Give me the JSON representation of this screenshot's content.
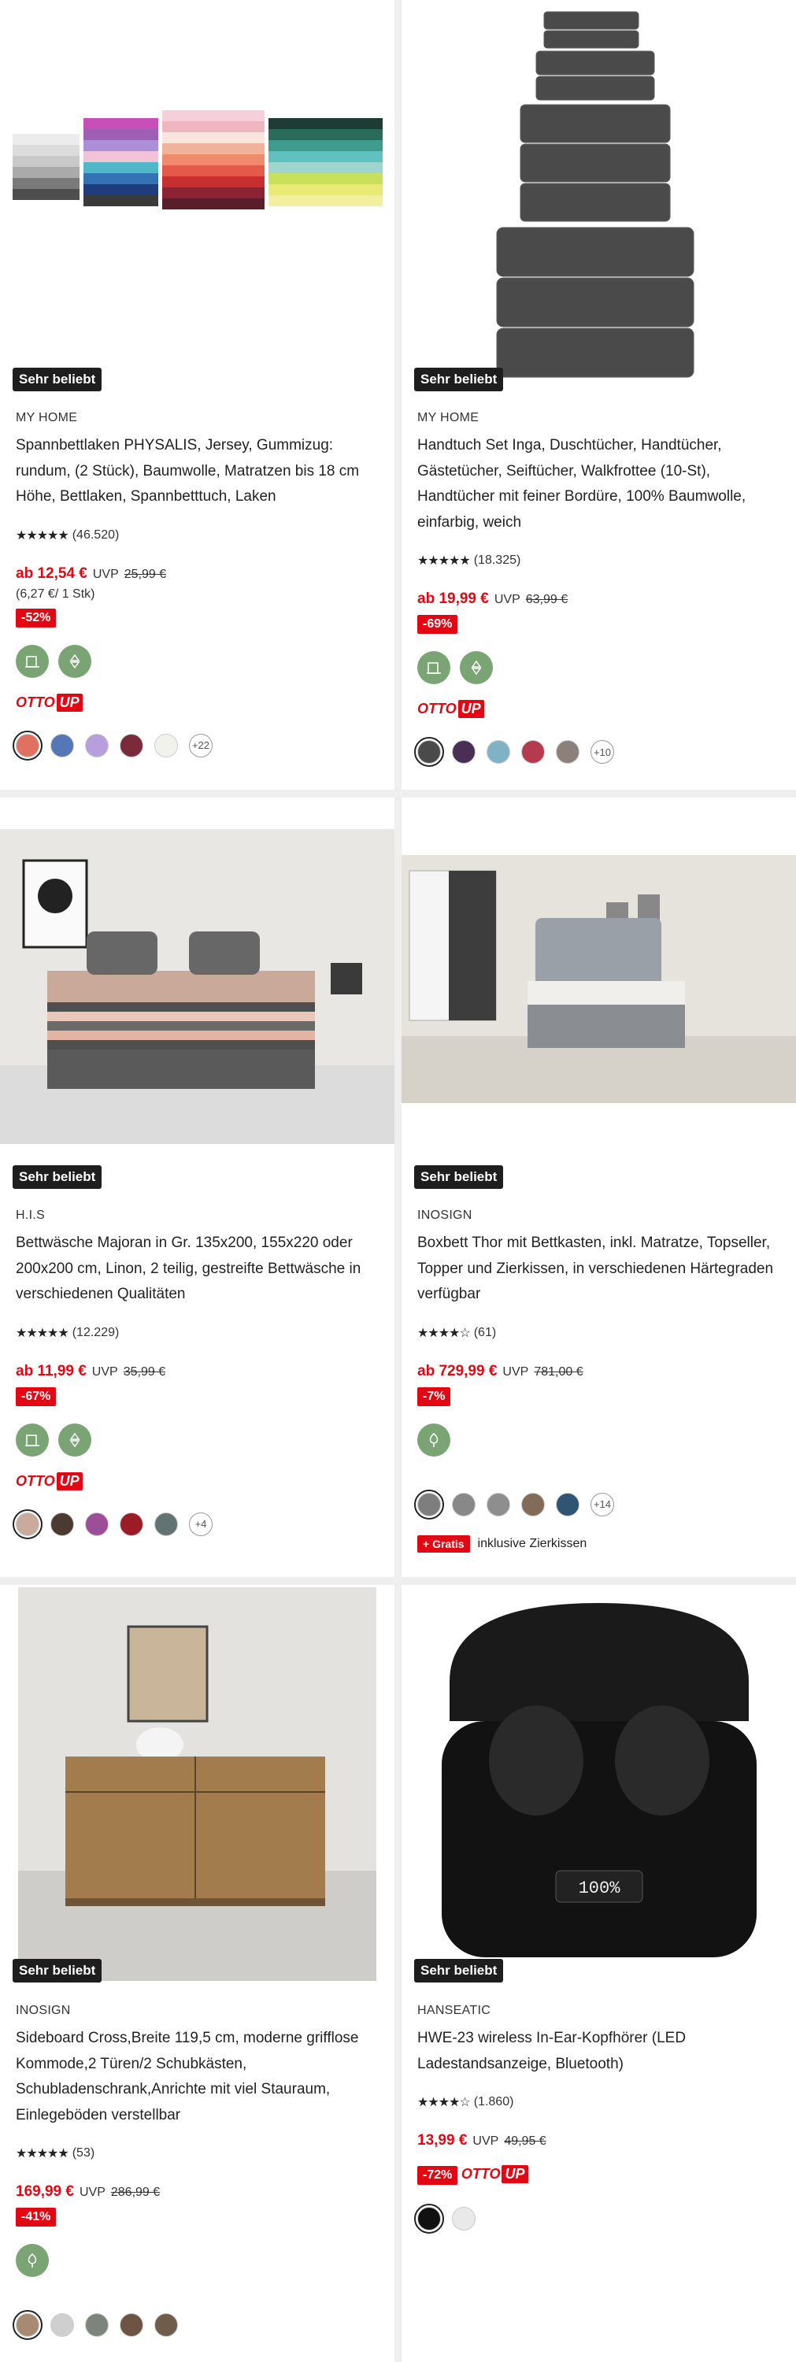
{
  "colors": {
    "price_red": "#e30613",
    "eco_green": "#7aa474",
    "badge_dark": "#1e1e1e"
  },
  "products": [
    {
      "badge": "Sehr beliebt",
      "brand": "MY HOME",
      "title": "Spannbettlaken PHYSALIS, Jersey, Gummizug: rundum, (2 Stück), Baumwolle, Matratzen bis 18 cm Höhe, Bettlaken, Spannbetttuch, Laken",
      "stars": "★★★★★",
      "rating_count": "(46.520)",
      "price": "ab 12,54 €",
      "uvp_label": "UVP",
      "old_price": "25,99 €",
      "unit_price": "(6,27 €/ 1 Stk)",
      "discount": "-52%",
      "eco_icons": [
        "sustainability-icon",
        "planet-icon"
      ],
      "otto_up": "OTTO",
      "otto_up_tag": "UP",
      "swatches": [
        "#e07060",
        "#5577b5",
        "#b79fde",
        "#7a2a3a",
        "#f2f2ec"
      ],
      "more": "+22"
    },
    {
      "badge": "Sehr beliebt",
      "brand": "MY HOME",
      "title": "Handtuch Set Inga, Duschtücher, Handtücher, Gästetücher, Seiftücher, Walkfrottee (10-St), Handtücher mit feiner Bordüre, 100% Baumwolle, einfarbig, weich",
      "stars": "★★★★★",
      "rating_count": "(18.325)",
      "price": "ab 19,99 €",
      "uvp_label": "UVP",
      "old_price": "63,99 €",
      "discount": "-69%",
      "eco_icons": [
        "sustainability-icon",
        "planet-icon"
      ],
      "otto_up": "OTTO",
      "otto_up_tag": "UP",
      "swatches": [
        "#4a4a4a",
        "#4a2f55",
        "#7fb2c7",
        "#b63a4e",
        "#8c817a"
      ],
      "more": "+10"
    },
    {
      "badge": "Sehr beliebt",
      "brand": "H.I.S",
      "title": "Bettwäsche Majoran in Gr. 135x200, 155x220 oder 200x200 cm, Linon, 2 teilig, gestreifte Bettwäsche in verschiedenen Qualitäten",
      "stars": "★★★★★",
      "rating_count": "(12.229)",
      "price": "ab 11,99 €",
      "uvp_label": "UVP",
      "old_price": "35,99 €",
      "discount": "-67%",
      "eco_icons": [
        "sustainability-icon",
        "planet-icon"
      ],
      "otto_up": "OTTO",
      "otto_up_tag": "UP",
      "swatches": [
        "#c9aa9b",
        "#4a3a30",
        "#9c4f96",
        "#9b1c24",
        "#627472"
      ],
      "more": "+4"
    },
    {
      "badge": "Sehr beliebt",
      "brand": "INOSIGN",
      "title": "Boxbett Thor mit Bettkasten, inkl. Matratze, Topseller, Topper und Zierkissen, in verschiedenen Härtegraden verfügbar",
      "stars": "★★★★☆",
      "rating_count": "(61)",
      "price": "ab 729,99 €",
      "uvp_label": "UVP",
      "old_price": "781,00 €",
      "discount": "-7%",
      "eco_icons": [
        "tree-icon"
      ],
      "swatches": [
        "#7e7e7e",
        "#888888",
        "#8e8e8e",
        "#836b59",
        "#2f5572"
      ],
      "more": "+14",
      "gratis_tag": "+ Gratis",
      "gratis_text": "inklusive Zierkissen"
    },
    {
      "badge": "Sehr beliebt",
      "brand": "INOSIGN",
      "title": "Sideboard Cross,Breite 119,5 cm, moderne grifflose Kommode,2 Türen/2 Schubkästen, Schubladenschrank,Anrichte mit viel Stauraum, Einlegeböden verstellbar",
      "stars": "★★★★★",
      "rating_count": "(53)",
      "price": "169,99 €",
      "uvp_label": "UVP",
      "old_price": "286,99 €",
      "discount": "-41%",
      "eco_icons": [
        "tree-icon"
      ],
      "swatches": [
        "#a88a72",
        "#cfcfcf",
        "#7d857a",
        "#6e5442",
        "#6f5c4b"
      ]
    },
    {
      "badge": "Sehr beliebt",
      "brand": "HANSEATIC",
      "title": "HWE-23 wireless In-Ear-Kopfhörer (LED Ladestandsanzeige, Bluetooth)",
      "stars": "★★★★☆",
      "rating_count": "(1.860)",
      "price": "13,99 €",
      "uvp_label": "UVP",
      "old_price": "49,95 €",
      "discount": "-72%",
      "otto_up": "OTTO",
      "otto_up_tag": "UP",
      "swatches": [
        "#111111",
        "#e9e9e9"
      ]
    }
  ]
}
